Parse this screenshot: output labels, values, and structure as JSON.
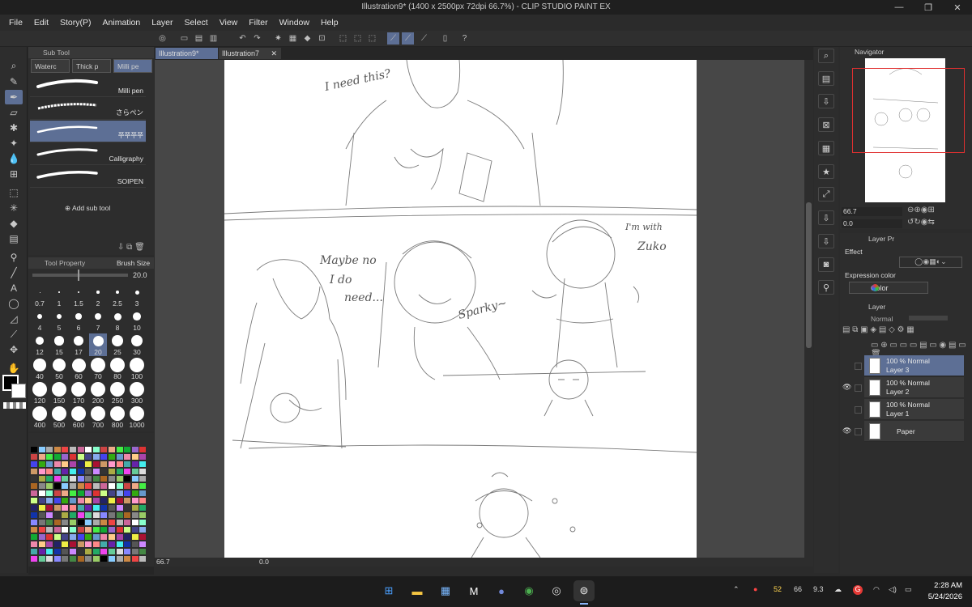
{
  "window": {
    "title": "Illustration9* (1400 x 2500px 72dpi 66.7%)  - CLIP STUDIO PAINT EX",
    "minimize": "—",
    "maximize": "❐",
    "close": "✕"
  },
  "menu": [
    "File",
    "Edit",
    "Story(P)",
    "Animation",
    "Layer",
    "Select",
    "View",
    "Filter",
    "Window",
    "Help"
  ],
  "sub_tool": {
    "panel_title": "Sub Tool",
    "tabs": [
      "Waterc",
      "Thick p",
      "Milli pe"
    ],
    "brushes": [
      "Milli pen",
      "さらペン",
      "쭈쭈쭈쭈",
      "Calligraphy",
      "SOIPEN"
    ],
    "add_label": "Add sub tool"
  },
  "tool_property": {
    "tab1": "Tool Property",
    "tab2": "Brush Size",
    "size_value": "20.0"
  },
  "brush_sizes": [
    "0.7",
    "1",
    "1.5",
    "2",
    "2.5",
    "3",
    "4",
    "5",
    "6",
    "7",
    "8",
    "10",
    "12",
    "15",
    "17",
    "20",
    "25",
    "30",
    "40",
    "50",
    "60",
    "70",
    "80",
    "100",
    "120",
    "150",
    "170",
    "200",
    "250",
    "300",
    "400",
    "500",
    "600",
    "700",
    "800",
    "1000"
  ],
  "selected_brush_size": "20",
  "document_tabs": [
    "Illustration9*",
    "Illustration7"
  ],
  "canvas_status": {
    "zoom": "66.7",
    "angle": "0.0"
  },
  "canvas_text": {
    "note1": "I need this?",
    "note2": "Maybe no",
    "note3": "I do",
    "note4": "need...",
    "note5": "Sparky~",
    "note6": "I'm with",
    "note7": "Zuko"
  },
  "navigator": {
    "title": "Navigator",
    "zoom": "66.7",
    "angle": "0.0"
  },
  "layer_property": {
    "title": "Layer Pr",
    "effect_label": "Effect",
    "expression_label": "Expression color",
    "expression_value": "Color"
  },
  "layer_panel": {
    "title": "Layer",
    "blend_mode": "Normal",
    "layers": [
      {
        "mode": "100 % Normal",
        "name": "Layer 3",
        "selected": true,
        "visible": false
      },
      {
        "mode": "100 % Normal",
        "name": "Layer 2",
        "selected": false,
        "visible": true
      },
      {
        "mode": "100 % Normal",
        "name": "Layer 1",
        "selected": false,
        "visible": false
      },
      {
        "mode": "",
        "name": "Paper",
        "selected": false,
        "visible": true
      }
    ]
  },
  "taskbar": {
    "tray_num1": "52",
    "tray_num2": "66",
    "tray_num3": "9.3",
    "time": "2:28 AM",
    "date": "5/24/2026"
  },
  "colors": {
    "accent": "#5d6f95",
    "panel": "#2d2d2d",
    "navigator_frame": "#e03030"
  },
  "icons": [
    "pen-icon",
    "eraser-icon",
    "fill-icon",
    "text-icon",
    "hand-icon",
    "eye-icon",
    "trash-icon",
    "windows-start-icon",
    "file-explorer-icon",
    "discord-icon",
    "chrome-icon",
    "clip-studio-icon"
  ]
}
